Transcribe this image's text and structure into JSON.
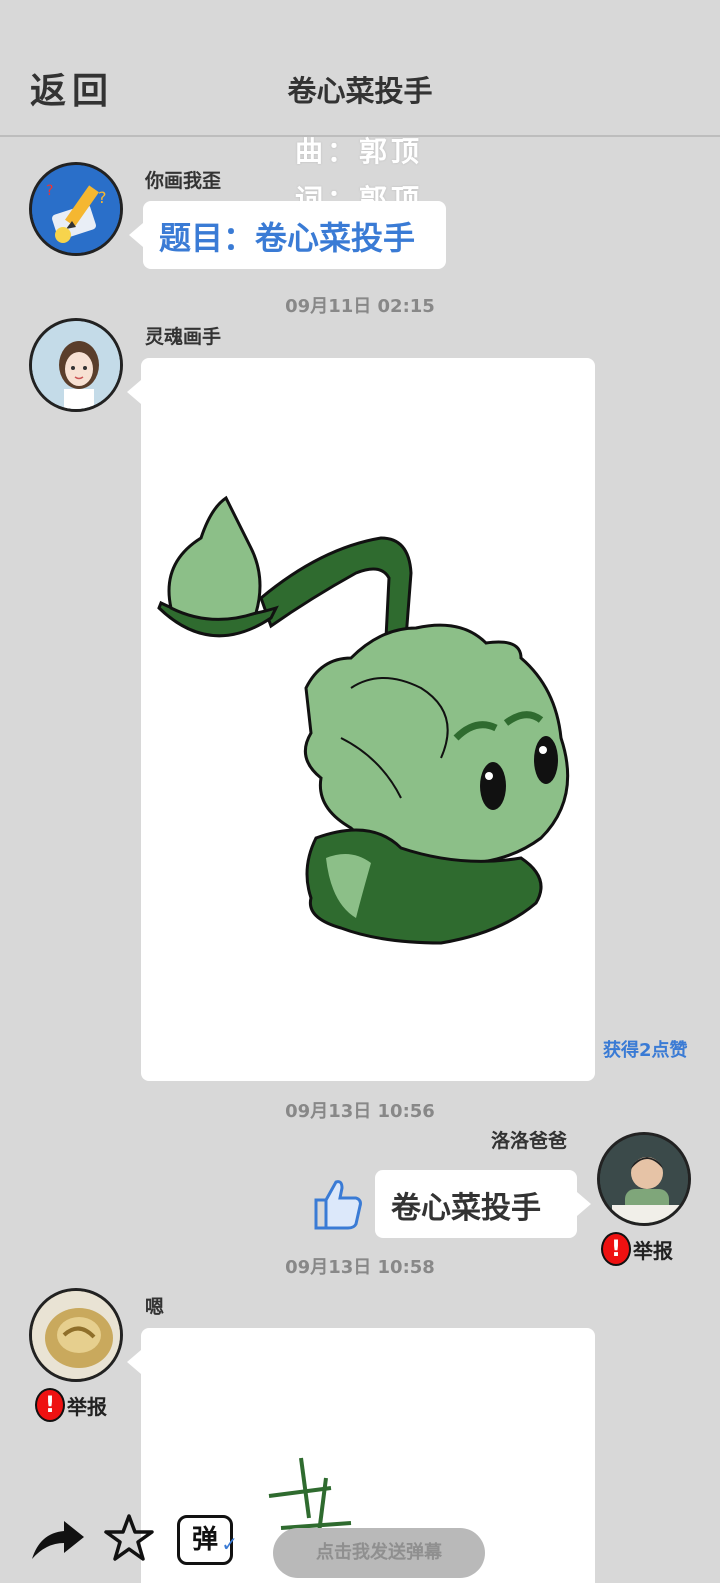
{
  "header": {
    "back_label": "返回",
    "title": "卷心菜投手"
  },
  "lyrics": {
    "line1": "曲：郭顶",
    "line2": "词：郭顶"
  },
  "messages": [
    {
      "user": "你画我歪",
      "text": "题目：卷心菜投手"
    },
    {
      "time": "09月11日  02:15",
      "user": "灵魂画手",
      "likes": "获得2点赞"
    },
    {
      "time": "09月13日  10:56",
      "user": "洛洛爸爸",
      "text": "卷心菜投手",
      "report": "举报"
    },
    {
      "time": "09月13日  10:58",
      "user": "嗯",
      "report": "举报"
    }
  ],
  "bottom": {
    "danmu_placeholder": "点击我发送弹幕",
    "danmu_icon_label": "弹"
  },
  "colors": {
    "background": "#d8d8d8",
    "accent": "#3a7bd5",
    "report_red": "#e11111",
    "cabbage_green": "#8cbf88",
    "dark_green": "#2f6b2f"
  }
}
